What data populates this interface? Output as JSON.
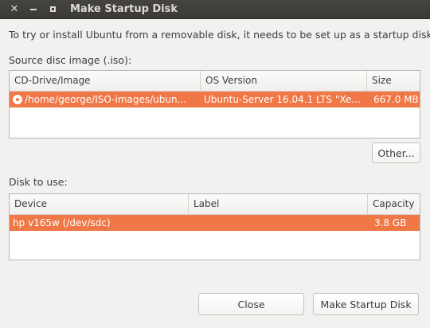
{
  "window": {
    "title": "Make Startup Disk"
  },
  "intro_text": "To try or install Ubuntu from a removable disk, it needs to be set up as a startup disk.",
  "source": {
    "label": "Source disc image (.iso):",
    "columns": [
      "CD-Drive/Image",
      "OS Version",
      "Size"
    ],
    "rows": [
      {
        "image": "/home/george/ISO-images/ubun...",
        "os_version": "Ubuntu-Server 16.04.1 LTS \"Xe...",
        "size": "667.0 MB",
        "selected": true
      }
    ],
    "other_button": "Other..."
  },
  "disk": {
    "label": "Disk to use:",
    "columns": [
      "Device",
      "Label",
      "Capacity"
    ],
    "rows": [
      {
        "device": "hp v165w (/dev/sdc)",
        "label": "",
        "capacity": "3.8 GB",
        "selected": true
      }
    ]
  },
  "buttons": {
    "close": "Close",
    "make": "Make Startup Disk"
  },
  "colors": {
    "selection": "#f07746",
    "titlebar": "#3c3b37"
  }
}
